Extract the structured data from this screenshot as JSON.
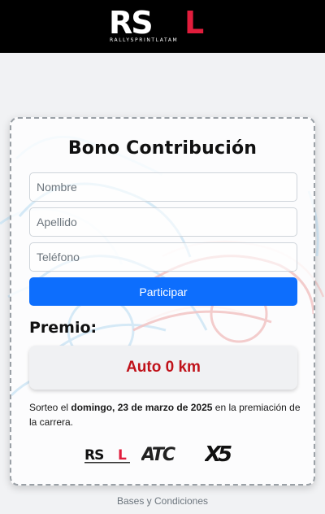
{
  "header": {
    "logo_text": "RSL",
    "logo_subtext": "RALLYSPRINTLATAM",
    "logo_accent": "#e11d3c"
  },
  "form": {
    "title": "Bono Contribución",
    "nombre_placeholder": "Nombre",
    "apellido_placeholder": "Apellido",
    "telefono_placeholder": "Teléfono",
    "submit_label": "Participar",
    "submit_color": "#0d6efd"
  },
  "prize": {
    "heading": "Premio:",
    "value": "Auto 0 km",
    "value_color": "#c0121a"
  },
  "draw": {
    "prefix": "Sorteo el ",
    "date_bold": "domingo, 23 de marzo de 2025",
    "suffix": " en la premiación de la carrera."
  },
  "sponsors": {
    "rsl": "RSL",
    "atc": "ATC",
    "x5": "X5"
  },
  "footer": {
    "link": "Bases y Condiciones"
  }
}
